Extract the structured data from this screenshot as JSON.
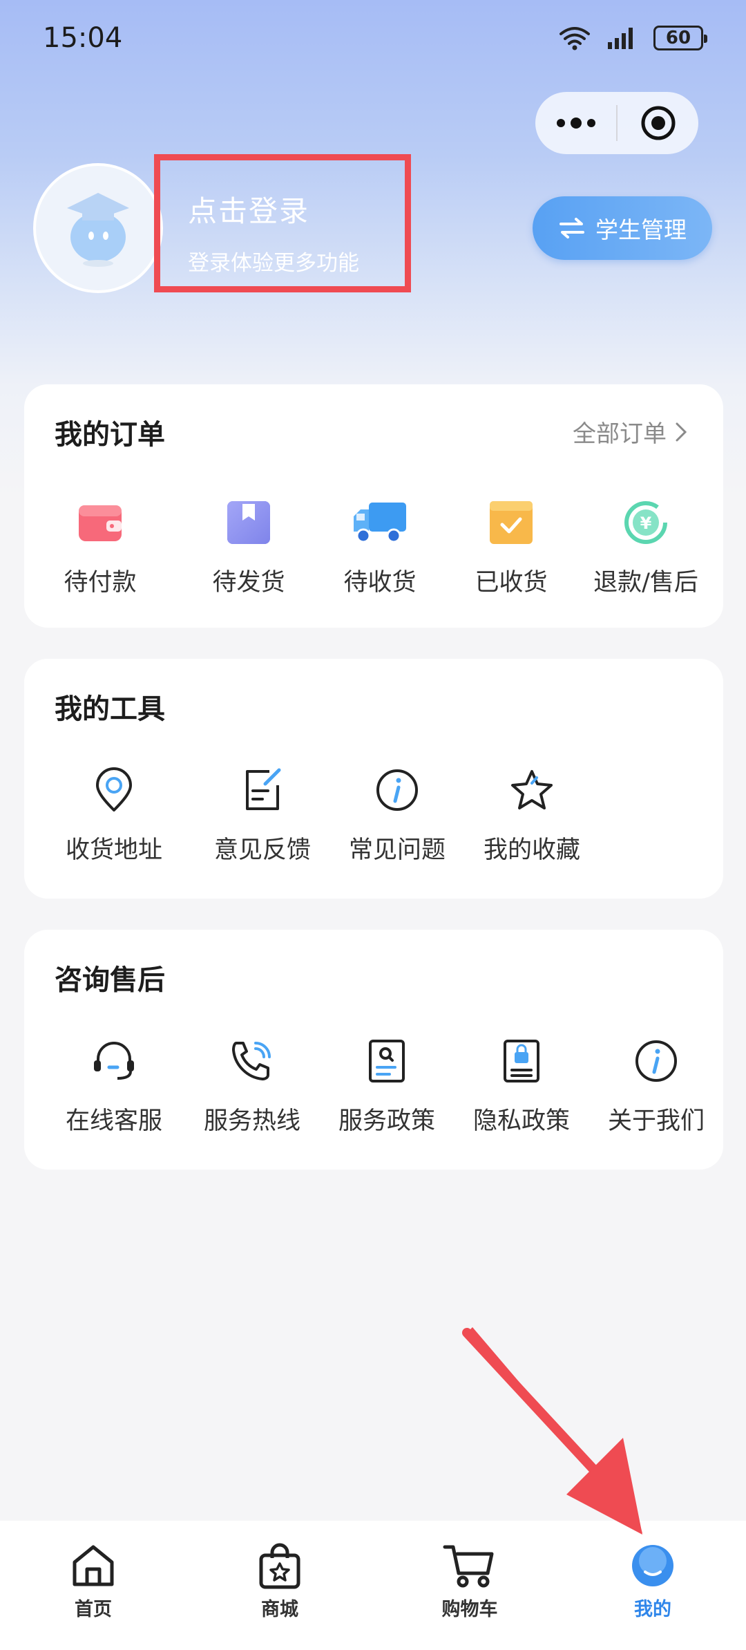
{
  "status": {
    "time": "15:04",
    "battery": "60"
  },
  "profile": {
    "login_title": "点击登录",
    "login_sub": "登录体验更多功能",
    "student_button": "学生管理"
  },
  "orders": {
    "title": "我的订单",
    "more": "全部订单",
    "items": [
      {
        "label": "待付款",
        "icon": "wallet-icon"
      },
      {
        "label": "待发货",
        "icon": "package-icon"
      },
      {
        "label": "待收货",
        "icon": "truck-icon"
      },
      {
        "label": "已收货",
        "icon": "box-check-icon"
      },
      {
        "label": "退款/售后",
        "icon": "refund-icon"
      }
    ]
  },
  "tools": {
    "title": "我的工具",
    "items": [
      {
        "label": "收货地址",
        "icon": "location-icon"
      },
      {
        "label": "意见反馈",
        "icon": "feedback-icon"
      },
      {
        "label": "常见问题",
        "icon": "info-icon"
      },
      {
        "label": "我的收藏",
        "icon": "star-icon"
      }
    ]
  },
  "service": {
    "title": "咨询售后",
    "items": [
      {
        "label": "在线客服",
        "icon": "headset-icon"
      },
      {
        "label": "服务热线",
        "icon": "phone-icon"
      },
      {
        "label": "服务政策",
        "icon": "policy-icon"
      },
      {
        "label": "隐私政策",
        "icon": "privacy-icon"
      },
      {
        "label": "关于我们",
        "icon": "about-icon"
      }
    ]
  },
  "tabbar": {
    "items": [
      {
        "label": "首页",
        "icon": "home-icon"
      },
      {
        "label": "商城",
        "icon": "shop-bag-icon"
      },
      {
        "label": "购物车",
        "icon": "cart-icon"
      },
      {
        "label": "我的",
        "icon": "profile-icon",
        "active": true
      }
    ]
  },
  "colors": {
    "accent": "#2f86ea",
    "highlight": "#ef4b52"
  }
}
